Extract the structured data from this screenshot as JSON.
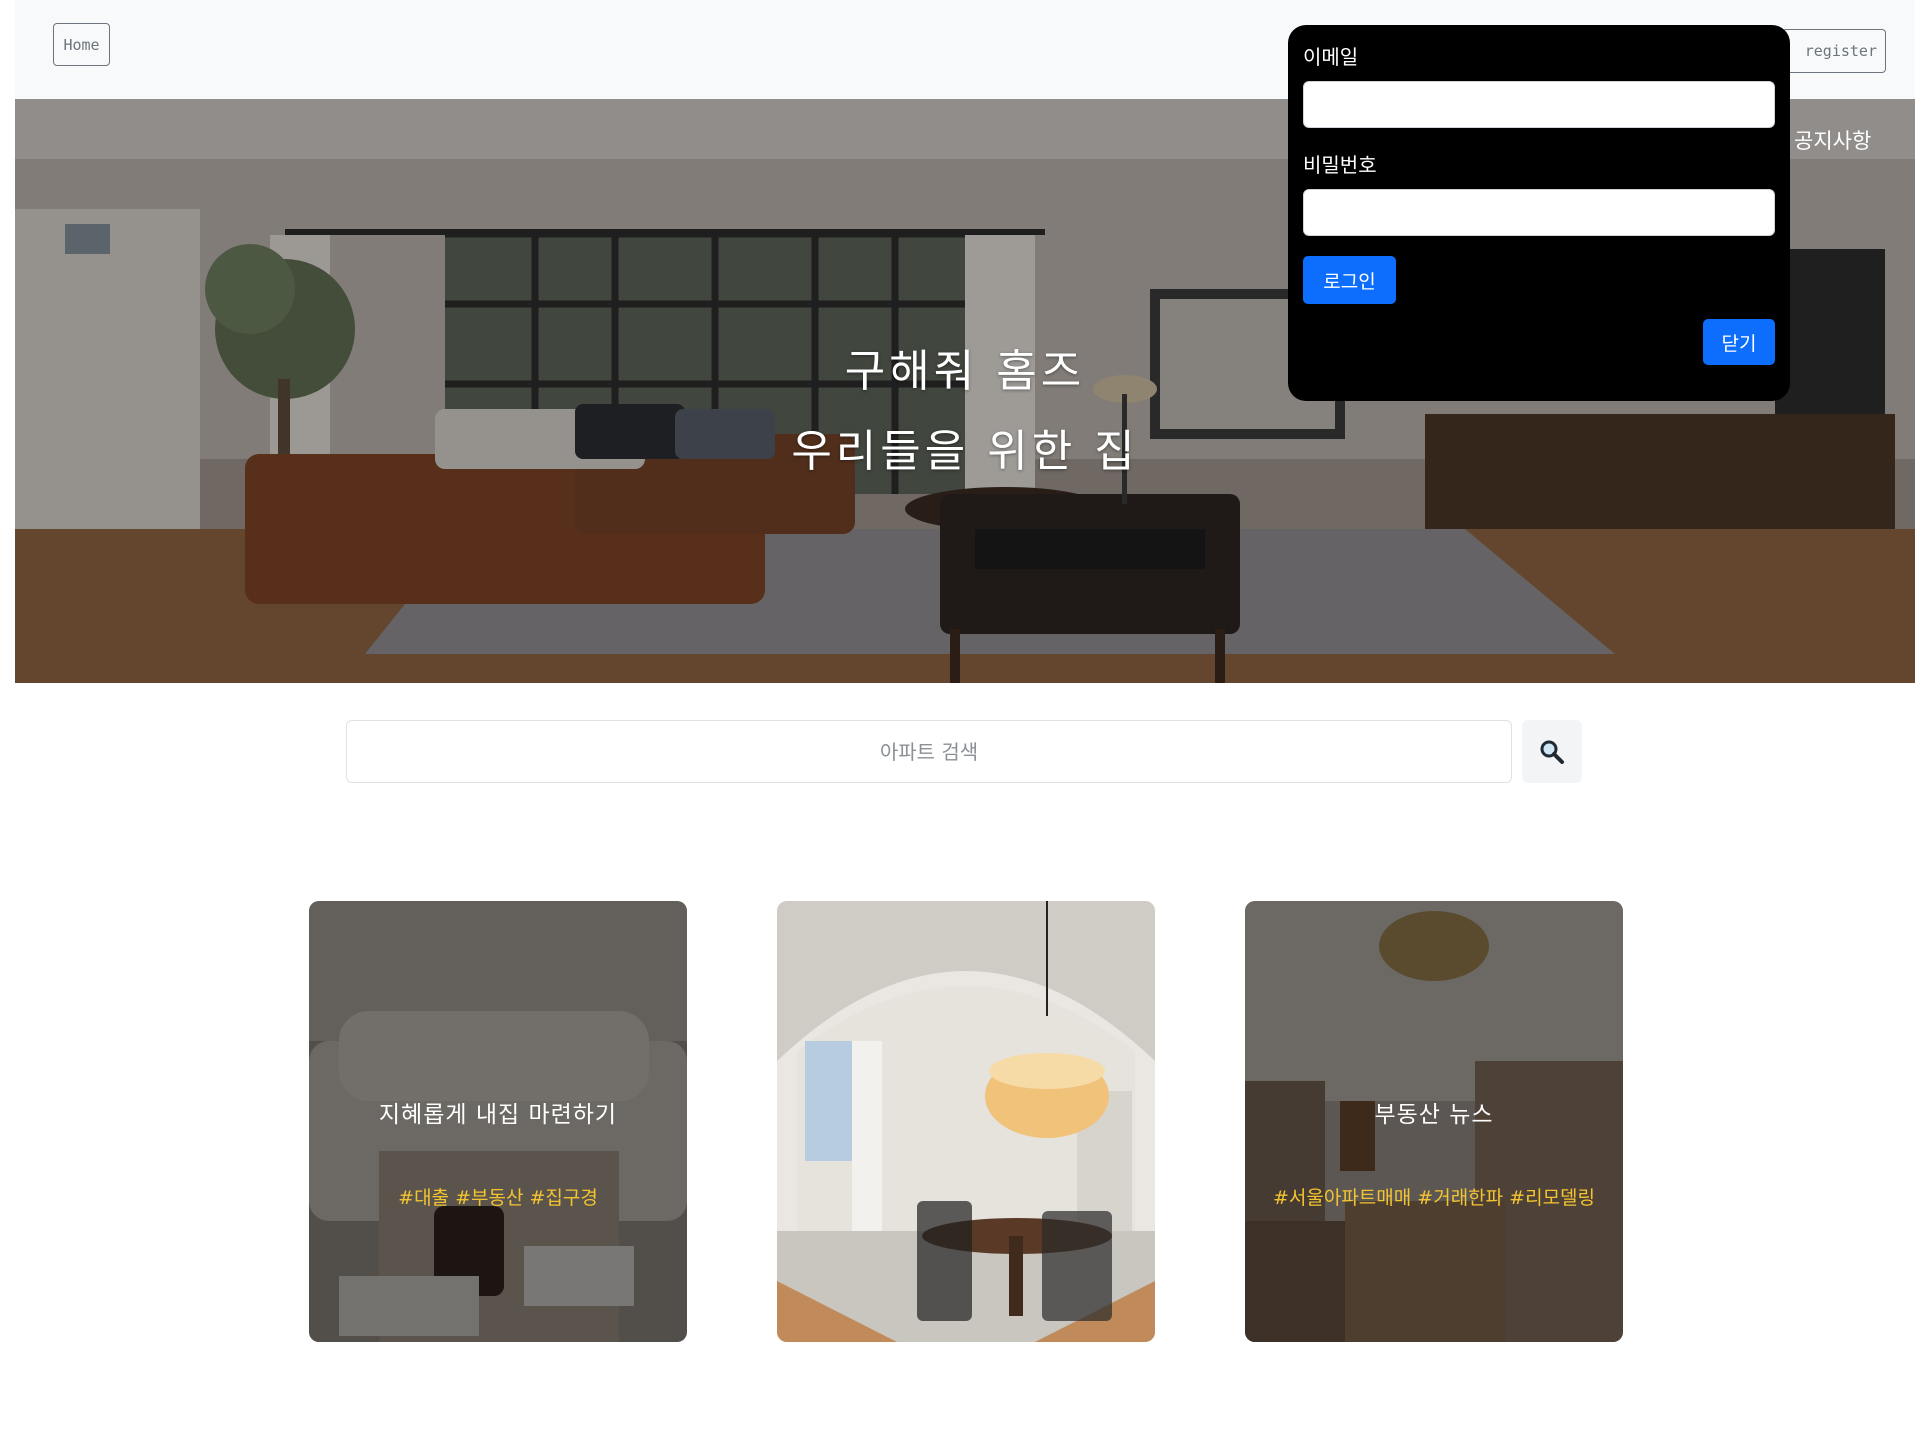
{
  "header": {
    "home_label": "Home",
    "register_label": "register"
  },
  "hero": {
    "title": "구해줘 홈즈",
    "subtitle": "우리들을 위한 집",
    "notice_label": "공지사항"
  },
  "login": {
    "email_label": "이메일",
    "email_value": "",
    "password_label": "비밀번호",
    "password_value": "",
    "login_button": "로그인",
    "close_button": "닫기"
  },
  "search": {
    "placeholder": "아파트 검색",
    "button_icon": "magnifier-icon"
  },
  "cards": [
    {
      "title": "지혜롭게 내집 마련하기",
      "tags": "#대출 #부동산 #집구경"
    },
    {
      "title": "",
      "tags": ""
    },
    {
      "title": "부동산 뉴스",
      "tags": "#서울아파트매매 #거래한파 #리모델링"
    }
  ],
  "colors": {
    "accent": "#0d6efd",
    "tag": "#f4c430",
    "header_bg": "#f8f9fa",
    "popup_bg": "#000000"
  }
}
